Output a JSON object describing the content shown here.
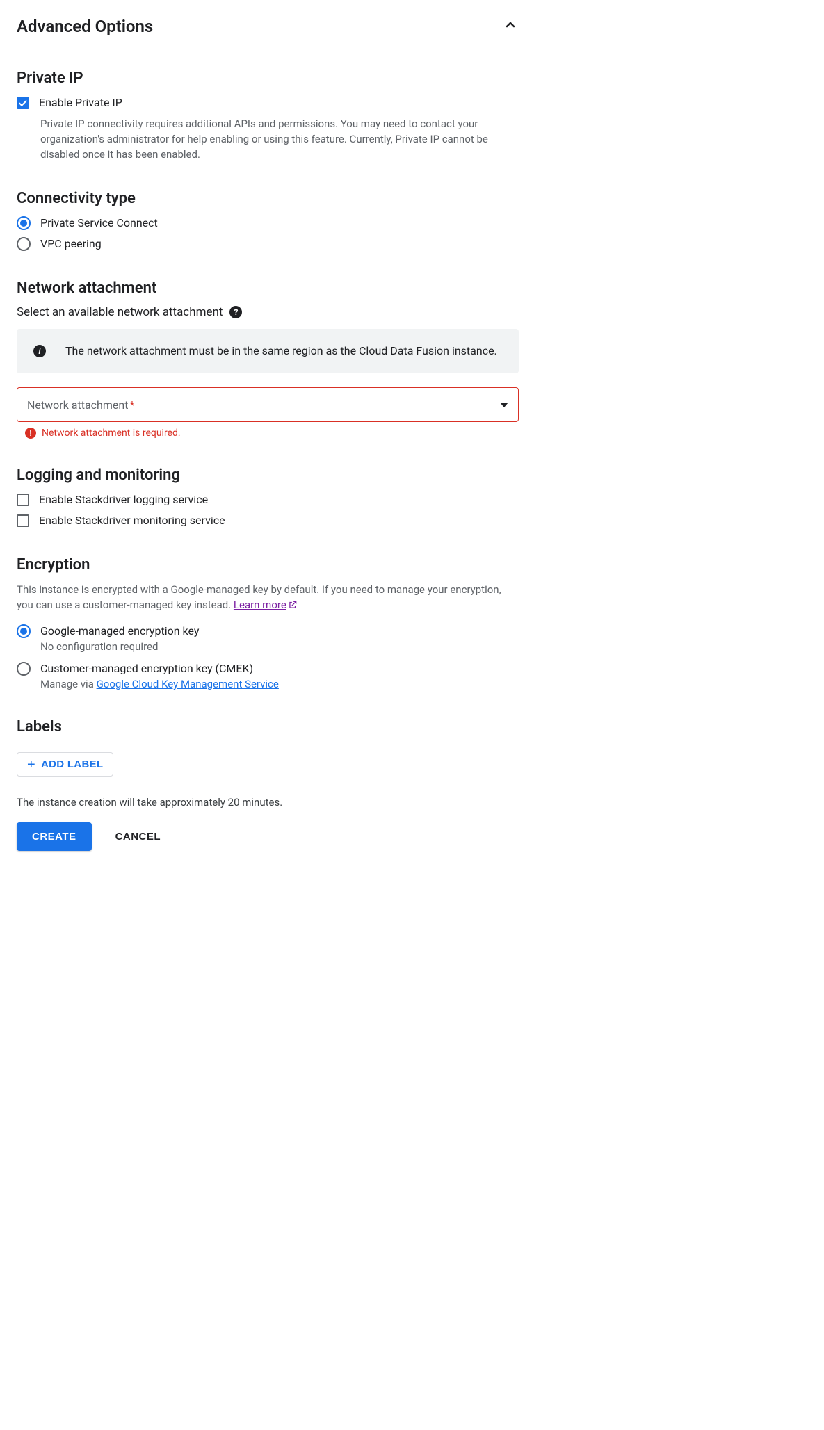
{
  "header": {
    "title": "Advanced Options"
  },
  "privateIp": {
    "heading": "Private IP",
    "enableLabel": "Enable Private IP",
    "helper": "Private IP connectivity requires additional APIs and permissions. You may need to contact your organization's administrator for help enabling or using this feature. Currently, Private IP cannot be disabled once it has been enabled."
  },
  "connectivity": {
    "heading": "Connectivity type",
    "options": {
      "psc": "Private Service Connect",
      "vpc": "VPC peering"
    }
  },
  "networkAttachment": {
    "heading": "Network attachment",
    "prompt": "Select an available network attachment",
    "banner": "The network attachment must be in the same region as the Cloud Data Fusion instance.",
    "placeholder": "Network attachment",
    "error": "Network attachment is required."
  },
  "logging": {
    "heading": "Logging and monitoring",
    "loggingLabel": "Enable Stackdriver logging service",
    "monitoringLabel": "Enable Stackdriver monitoring service"
  },
  "encryption": {
    "heading": "Encryption",
    "body": "This instance is encrypted with a Google-managed key by default. If you need to manage your encryption, you can use a customer-managed key instead. ",
    "learnMore": "Learn more",
    "googleOption": "Google-managed encryption key",
    "googleSub": "No configuration required",
    "cmekOption": "Customer-managed encryption key (CMEK)",
    "cmekSubPrefix": "Manage via ",
    "cmekLink": "Google Cloud Key Management Service"
  },
  "labels": {
    "heading": "Labels",
    "addButton": "ADD LABEL"
  },
  "footer": {
    "note": "The instance creation will take approximately 20 minutes.",
    "create": "CREATE",
    "cancel": "CANCEL"
  }
}
